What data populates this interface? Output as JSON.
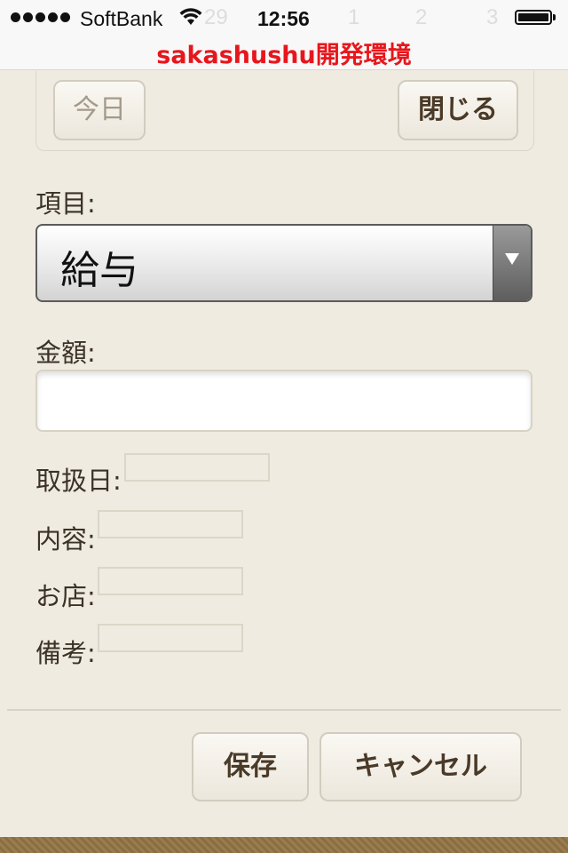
{
  "status_bar": {
    "carrier": "SoftBank",
    "time": "12:56",
    "ghost_numbers": [
      "29",
      "1",
      "2",
      "3"
    ]
  },
  "env_title": "sakashushu開発環境",
  "date_picker": {
    "today_label": "今日",
    "close_label": "閉じる"
  },
  "form": {
    "item_label": "項目:",
    "item_value": "給与",
    "amount_label": "金額:",
    "amount_value": "",
    "date_label": "取扱日:",
    "content_label": "内容:",
    "shop_label": "お店:",
    "note_label": "備考:"
  },
  "actions": {
    "save_label": "保存",
    "cancel_label": "キャンセル"
  },
  "colors": {
    "env_title": "#e8161c",
    "background": "#efebe1"
  }
}
